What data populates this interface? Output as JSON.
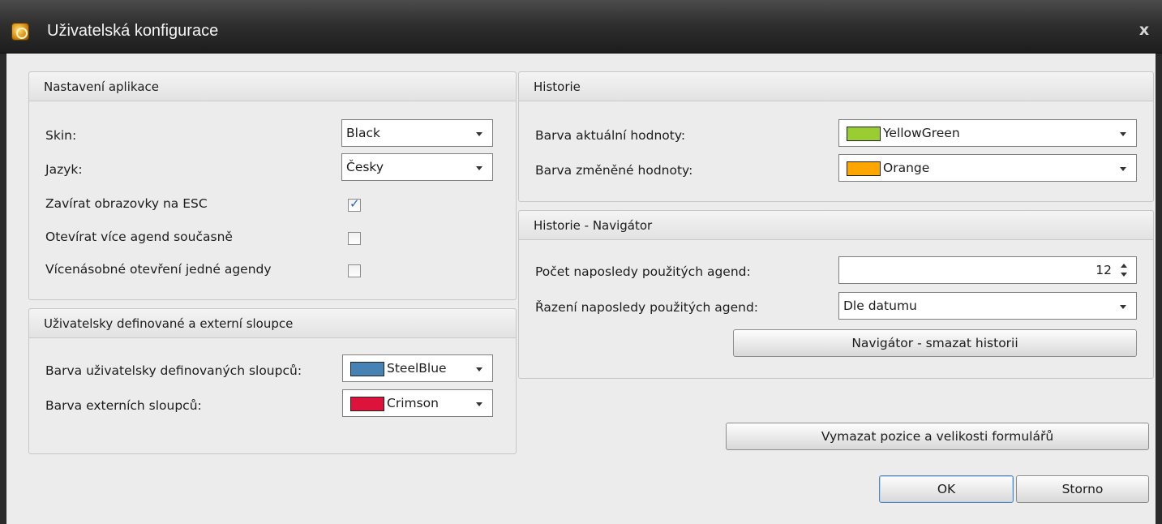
{
  "window": {
    "title": "Uživatelská konfigurace",
    "icon": "app-gear-icon",
    "close_icon": "close-icon"
  },
  "app_settings": {
    "header": "Nastavení aplikace",
    "skin_label": "Skin:",
    "skin_value": "Black",
    "language_label": "Jazyk:",
    "language_value": "Česky",
    "close_esc_label": "Zavírat obrazovky na ESC",
    "close_esc_checked": true,
    "open_multiple_label": "Otevírat více agend současně",
    "open_multiple_checked": false,
    "multi_open_label": "Vícenásobné otevření jedné agendy",
    "multi_open_checked": false
  },
  "user_columns": {
    "header": "Uživatelsky definované a externí sloupce",
    "user_color_label": "Barva uživatelsky definovaných sloupců:",
    "user_color_value": "SteelBlue",
    "user_color_hex": "#4682b4",
    "external_color_label": "Barva externích sloupců:",
    "external_color_value": "Crimson",
    "external_color_hex": "#dc143c"
  },
  "history": {
    "header": "Historie",
    "current_color_label": "Barva aktuální hodnoty:",
    "current_color_value": "YellowGreen",
    "current_color_hex": "#9acd32",
    "changed_color_label": "Barva změněné hodnoty:",
    "changed_color_value": "Orange",
    "changed_color_hex": "#ffa500"
  },
  "navigator": {
    "header": "Historie - Navigátor",
    "count_label": "Počet naposledy použitých agend:",
    "count_value": "12",
    "sort_label": "Řazení naposledy použitých agend:",
    "sort_value": "Dle datumu",
    "clear_button": "Navigátor - smazat historii"
  },
  "actions": {
    "reset_layout_button": "Vymazat pozice a velikosti formulářů",
    "ok_button": "OK",
    "cancel_button": "Storno"
  }
}
